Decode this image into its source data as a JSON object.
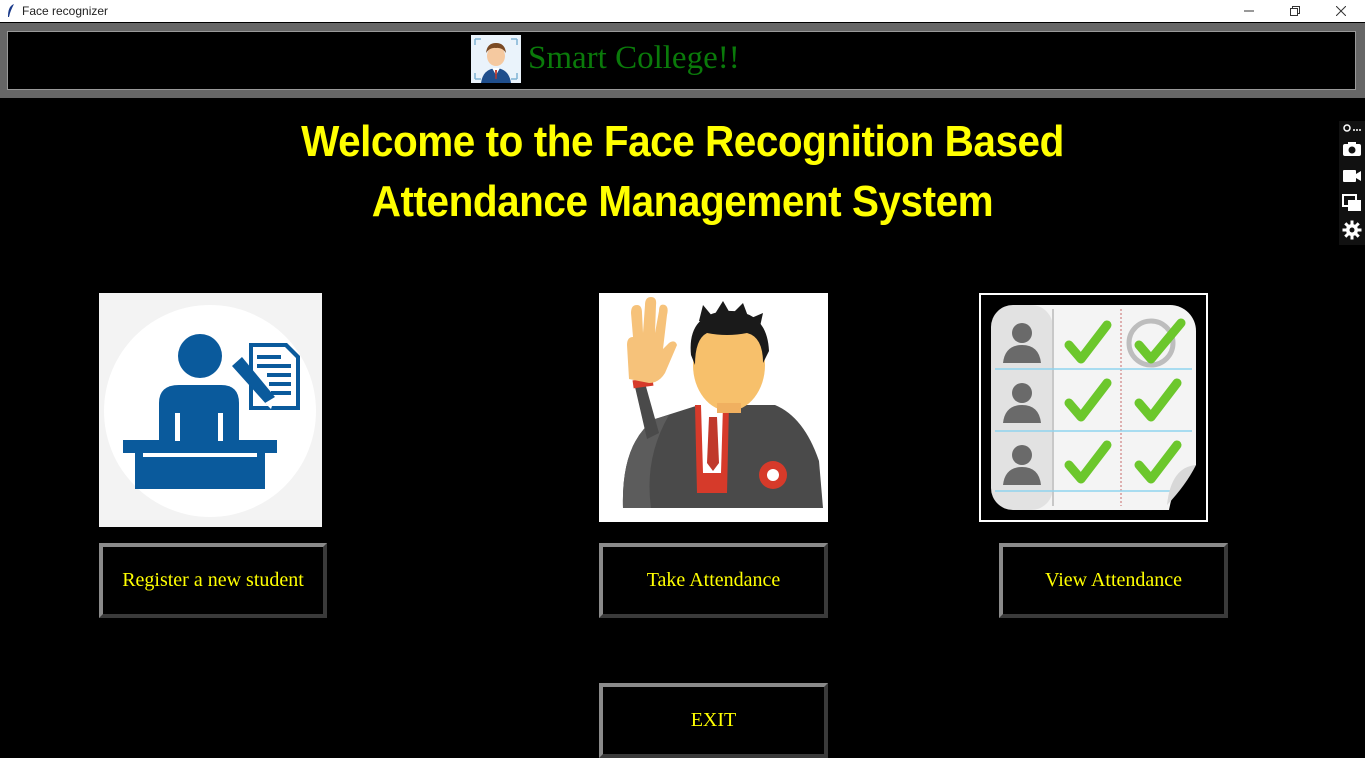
{
  "window": {
    "title": "Face recognizer",
    "controls": [
      "minimize-icon",
      "restore-icon",
      "close-icon"
    ]
  },
  "header": {
    "logo_icon": "person-face-icon",
    "brand": "Smart College!!",
    "brand_color": "#0a7a0a"
  },
  "headline": {
    "line1": "Welcome to the Face Recognition Based",
    "line2": "Attendance Management System",
    "color": "#ffff00"
  },
  "side_toolbar": [
    "pin-icon",
    "camera-icon",
    "video-icon",
    "copy-icon",
    "gear-icon"
  ],
  "actions": {
    "register": {
      "label": "Register a new student",
      "icon": "register-student-icon"
    },
    "take": {
      "label": "Take Attendance",
      "icon": "raised-hand-student-icon"
    },
    "view": {
      "label": "View Attendance",
      "icon": "attendance-checklist-icon"
    },
    "exit": {
      "label": "EXIT"
    }
  },
  "colors": {
    "background": "#000000",
    "button_text": "#ffff00",
    "register_blue": "#0a5a9c",
    "check_green": "#6cc72c"
  }
}
